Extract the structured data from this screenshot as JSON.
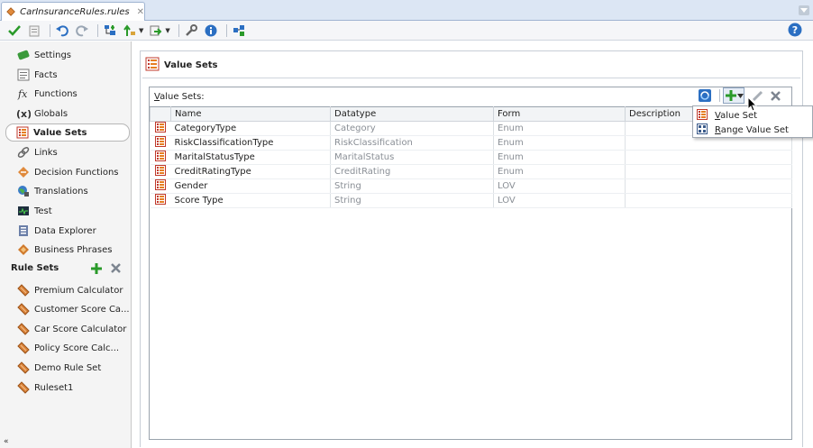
{
  "tab": {
    "filename": "CarInsuranceRules.rules",
    "close": "✕"
  },
  "help": "?",
  "sidebar": {
    "items": [
      {
        "label": "Settings",
        "icon": "settings-icon"
      },
      {
        "label": "Facts",
        "icon": "facts-icon"
      },
      {
        "label": "Functions",
        "icon": "function-icon"
      },
      {
        "label": "Globals",
        "icon": "globals-icon"
      },
      {
        "label": "Value Sets",
        "icon": "valueset-icon",
        "active": true
      },
      {
        "label": "Links",
        "icon": "link-icon"
      },
      {
        "label": "Decision Functions",
        "icon": "decision-function-icon"
      },
      {
        "label": "Translations",
        "icon": "translations-icon"
      },
      {
        "label": "Test",
        "icon": "test-icon"
      },
      {
        "label": "Data Explorer",
        "icon": "data-explorer-icon"
      },
      {
        "label": "Business Phrases",
        "icon": "business-phrases-icon"
      }
    ],
    "rule_sets_header": "Rule Sets",
    "rule_sets": [
      {
        "label": "Premium Calculator"
      },
      {
        "label": "Customer Score Ca..."
      },
      {
        "label": "Car Score Calculator"
      },
      {
        "label": "Policy Score Calc..."
      },
      {
        "label": "Demo Rule Set"
      },
      {
        "label": "Ruleset1"
      }
    ]
  },
  "main": {
    "title": "Value Sets",
    "box_label_prefix": "V",
    "box_label_rest": "alue Sets:",
    "columns": [
      "Name",
      "Datatype",
      "Form",
      "Description"
    ],
    "rows": [
      {
        "name": "CategoryType",
        "datatype": "Category",
        "form": "Enum",
        "description": ""
      },
      {
        "name": "RiskClassificationType",
        "datatype": "RiskClassification",
        "form": "Enum",
        "description": ""
      },
      {
        "name": "MaritalStatusType",
        "datatype": "MaritalStatus",
        "form": "Enum",
        "description": ""
      },
      {
        "name": "CreditRatingType",
        "datatype": "CreditRating",
        "form": "Enum",
        "description": ""
      },
      {
        "name": "Gender",
        "datatype": "String",
        "form": "LOV",
        "description": ""
      },
      {
        "name": "Score Type",
        "datatype": "String",
        "form": "LOV",
        "description": ""
      }
    ]
  },
  "dropdown": {
    "items": [
      {
        "underline": "V",
        "rest": "alue Set"
      },
      {
        "underline": "R",
        "rest": "ange Value Set"
      }
    ]
  },
  "collapse": "«"
}
